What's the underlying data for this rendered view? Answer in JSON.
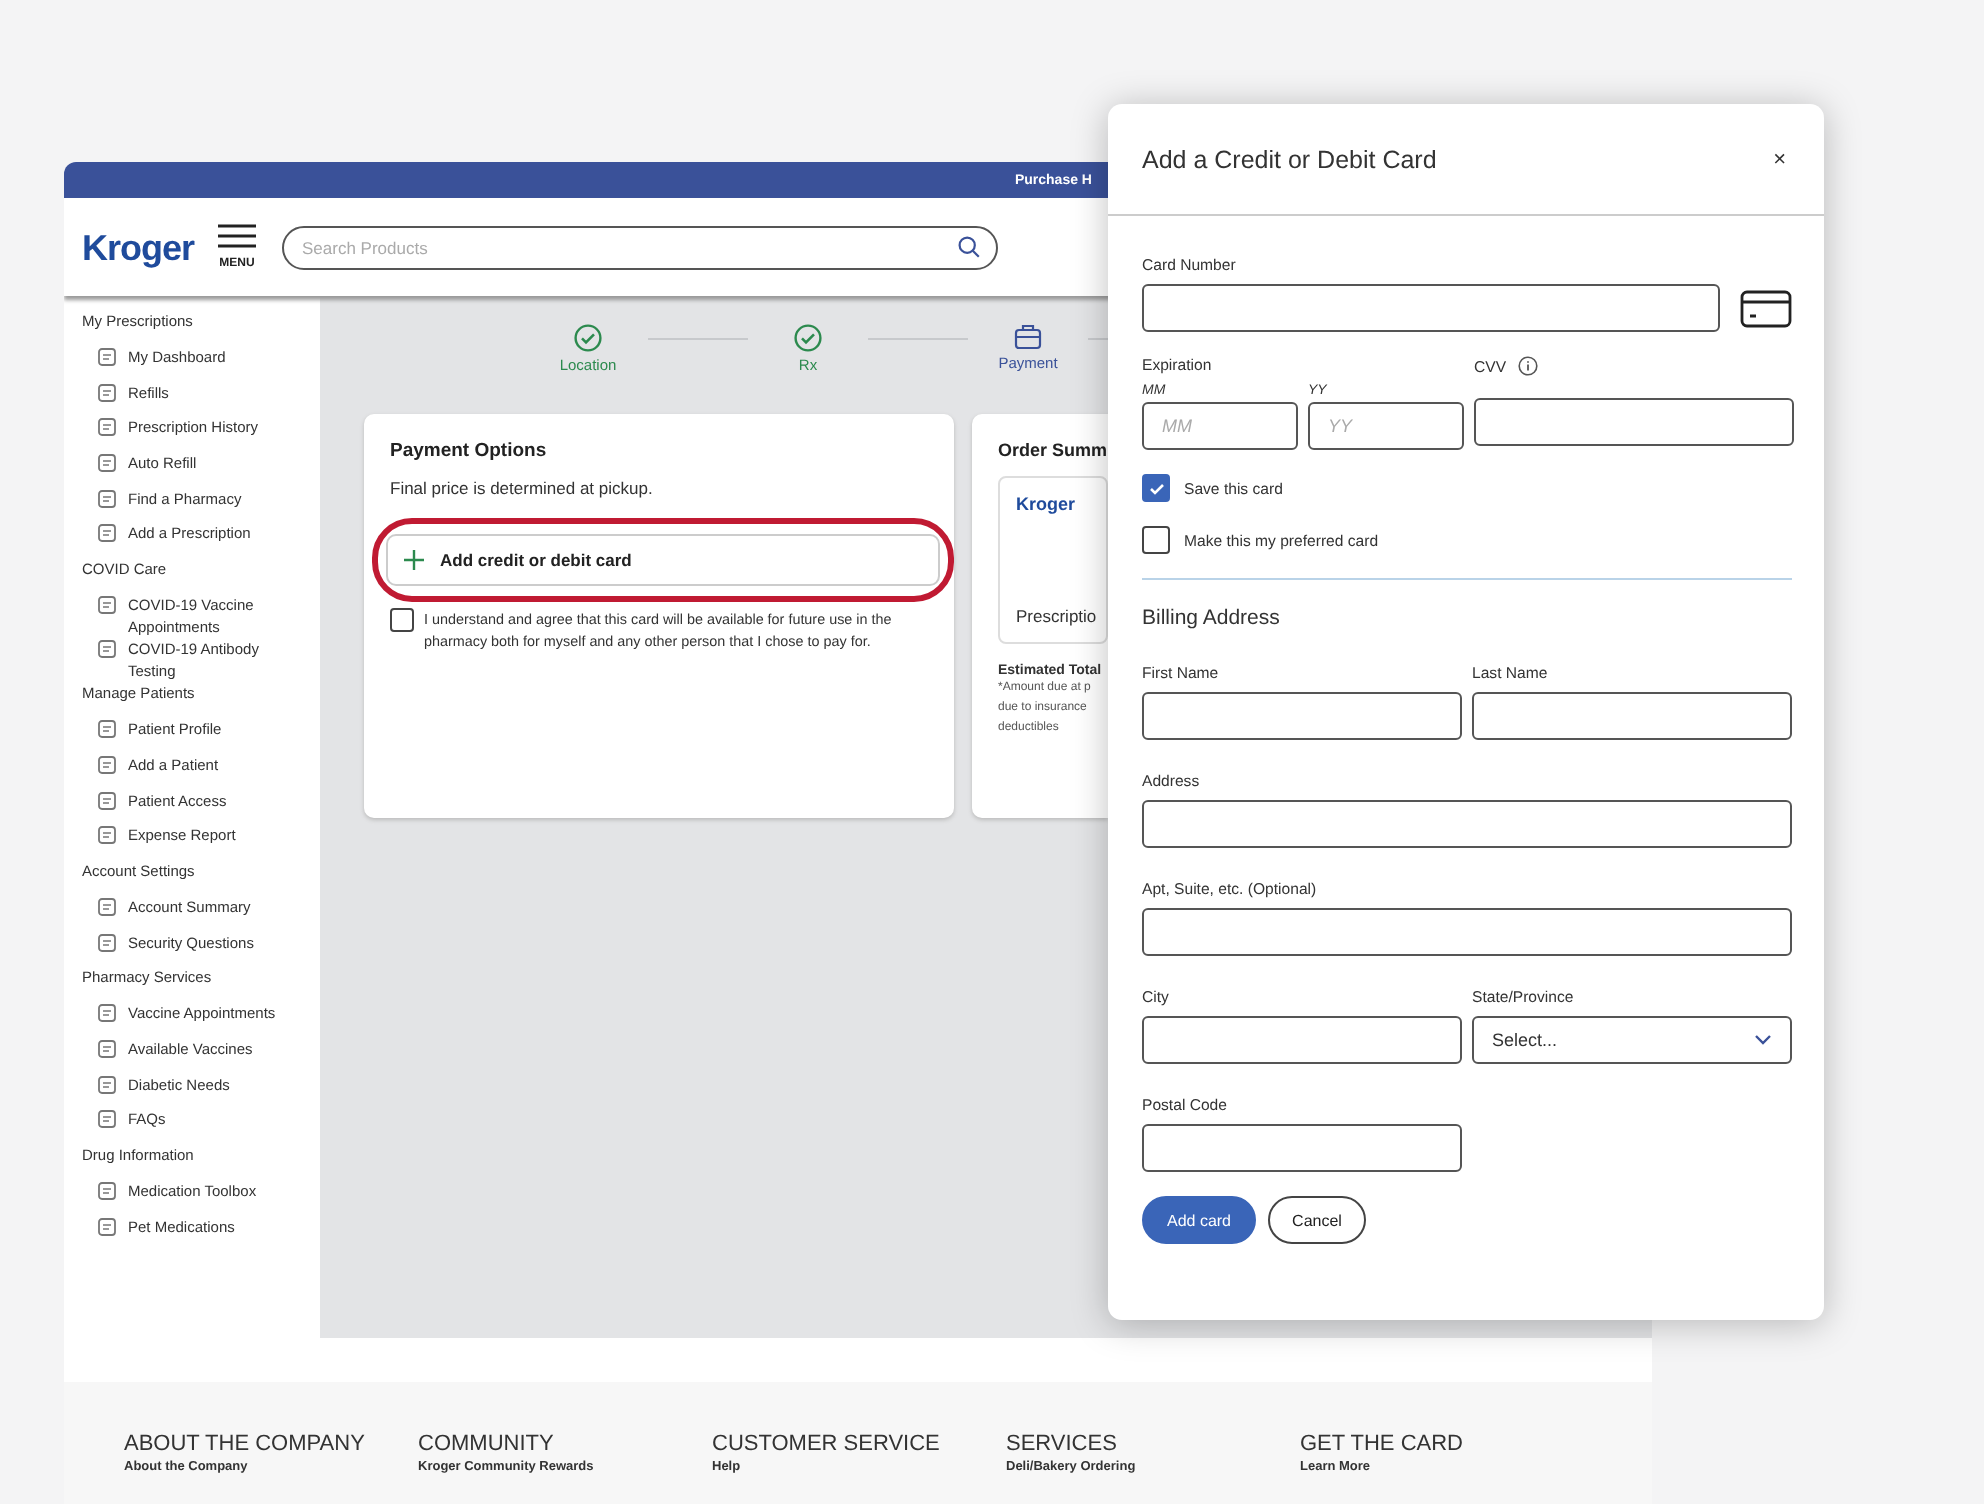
{
  "top_bar": {
    "link": "Purchase H"
  },
  "header": {
    "logo": "Kroger",
    "menu_label": "MENU",
    "search": {
      "placeholder": "Search Products"
    }
  },
  "sidebar": {
    "sections": [
      {
        "title": "My Prescriptions",
        "items": [
          "My Dashboard",
          "Refills",
          "Prescription History",
          "Auto Refill",
          "Find a Pharmacy",
          "Add a Prescription"
        ]
      },
      {
        "title": "COVID Care",
        "items": [
          "COVID-19 Vaccine Appointments",
          "COVID-19 Antibody Testing"
        ]
      },
      {
        "title": "Manage Patients",
        "items": [
          "Patient Profile",
          "Add a Patient",
          "Patient Access",
          "Expense Report"
        ]
      },
      {
        "title": "Account Settings",
        "items": [
          "Account Summary",
          "Security Questions"
        ]
      },
      {
        "title": "Pharmacy Services",
        "items": [
          "Vaccine Appointments",
          "Available Vaccines",
          "Diabetic Needs",
          "FAQs"
        ]
      },
      {
        "title": "Drug Information",
        "items": [
          "Medication Toolbox",
          "Pet Medications"
        ]
      }
    ]
  },
  "stepper": [
    {
      "label": "Location",
      "kind": "done"
    },
    {
      "label": "Rx",
      "kind": "done"
    },
    {
      "label": "Payment",
      "kind": "current"
    }
  ],
  "payment_options": {
    "title": "Payment Options",
    "note": "Final price is determined at pickup.",
    "add_button": "Add credit or debit card",
    "highlighted": true,
    "agreement": {
      "text": "I understand and agree that this card will be available for future use in the pharmacy both for myself and any other person that I chose to pay for.",
      "checked": false
    }
  },
  "order_summary": {
    "title": "Order Summ",
    "logo": "Kroger",
    "item": "Prescriptio",
    "total_label": "Estimated Total",
    "note_lines": [
      "*Amount due at p",
      "due to insurance",
      "deductibles"
    ]
  },
  "footer": {
    "columns": [
      {
        "heading": "ABOUT THE COMPANY",
        "link": "About the Company"
      },
      {
        "heading": "COMMUNITY",
        "link": "Kroger Community Rewards"
      },
      {
        "heading": "CUSTOMER SERVICE",
        "link": "Help"
      },
      {
        "heading": "SERVICES",
        "link": "Deli/Bakery Ordering"
      },
      {
        "heading": "GET THE CARD",
        "link": "Learn More"
      }
    ]
  },
  "modal": {
    "title": "Add a Credit or Debit Card",
    "close": "×",
    "card_number": {
      "label": "Card Number"
    },
    "expiration": {
      "label": "Expiration",
      "month": {
        "label": "MM",
        "placeholder": "MM"
      },
      "year": {
        "label": "YY",
        "placeholder": "YY"
      }
    },
    "cvv": {
      "label": "CVV"
    },
    "checkboxes": [
      {
        "label": "Save this card",
        "checked": true
      },
      {
        "label": "Make this my preferred card",
        "checked": false
      }
    ],
    "billing_title": "Billing Address",
    "first_name": {
      "label": "First Name"
    },
    "last_name": {
      "label": "Last Name"
    },
    "address": {
      "label": "Address"
    },
    "apt": {
      "label": "Apt, Suite, etc. (Optional)"
    },
    "city": {
      "label": "City"
    },
    "state": {
      "label": "State/Province",
      "value": "Select..."
    },
    "postal_code": {
      "label": "Postal Code"
    },
    "buttons": [
      {
        "label": "Add card",
        "kind": "primary"
      },
      {
        "label": "Cancel",
        "kind": "secondary"
      }
    ]
  }
}
